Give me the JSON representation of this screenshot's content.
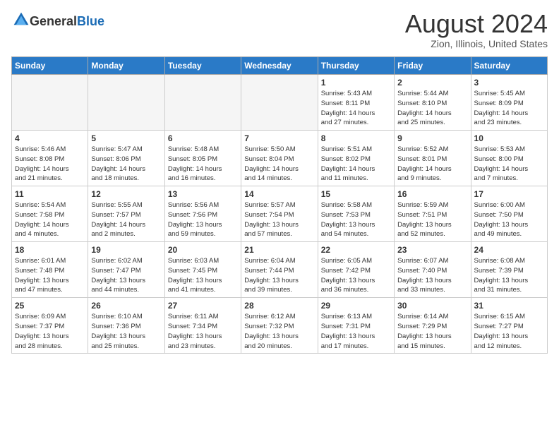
{
  "header": {
    "logo_general": "General",
    "logo_blue": "Blue",
    "title": "August 2024",
    "location": "Zion, Illinois, United States"
  },
  "days_of_week": [
    "Sunday",
    "Monday",
    "Tuesday",
    "Wednesday",
    "Thursday",
    "Friday",
    "Saturday"
  ],
  "weeks": [
    [
      {
        "day": "",
        "info": "",
        "empty": true
      },
      {
        "day": "",
        "info": "",
        "empty": true
      },
      {
        "day": "",
        "info": "",
        "empty": true
      },
      {
        "day": "",
        "info": "",
        "empty": true
      },
      {
        "day": "1",
        "info": "Sunrise: 5:43 AM\nSunset: 8:11 PM\nDaylight: 14 hours\nand 27 minutes."
      },
      {
        "day": "2",
        "info": "Sunrise: 5:44 AM\nSunset: 8:10 PM\nDaylight: 14 hours\nand 25 minutes."
      },
      {
        "day": "3",
        "info": "Sunrise: 5:45 AM\nSunset: 8:09 PM\nDaylight: 14 hours\nand 23 minutes."
      }
    ],
    [
      {
        "day": "4",
        "info": "Sunrise: 5:46 AM\nSunset: 8:08 PM\nDaylight: 14 hours\nand 21 minutes."
      },
      {
        "day": "5",
        "info": "Sunrise: 5:47 AM\nSunset: 8:06 PM\nDaylight: 14 hours\nand 18 minutes."
      },
      {
        "day": "6",
        "info": "Sunrise: 5:48 AM\nSunset: 8:05 PM\nDaylight: 14 hours\nand 16 minutes."
      },
      {
        "day": "7",
        "info": "Sunrise: 5:50 AM\nSunset: 8:04 PM\nDaylight: 14 hours\nand 14 minutes."
      },
      {
        "day": "8",
        "info": "Sunrise: 5:51 AM\nSunset: 8:02 PM\nDaylight: 14 hours\nand 11 minutes."
      },
      {
        "day": "9",
        "info": "Sunrise: 5:52 AM\nSunset: 8:01 PM\nDaylight: 14 hours\nand 9 minutes."
      },
      {
        "day": "10",
        "info": "Sunrise: 5:53 AM\nSunset: 8:00 PM\nDaylight: 14 hours\nand 7 minutes."
      }
    ],
    [
      {
        "day": "11",
        "info": "Sunrise: 5:54 AM\nSunset: 7:58 PM\nDaylight: 14 hours\nand 4 minutes."
      },
      {
        "day": "12",
        "info": "Sunrise: 5:55 AM\nSunset: 7:57 PM\nDaylight: 14 hours\nand 2 minutes."
      },
      {
        "day": "13",
        "info": "Sunrise: 5:56 AM\nSunset: 7:56 PM\nDaylight: 13 hours\nand 59 minutes."
      },
      {
        "day": "14",
        "info": "Sunrise: 5:57 AM\nSunset: 7:54 PM\nDaylight: 13 hours\nand 57 minutes."
      },
      {
        "day": "15",
        "info": "Sunrise: 5:58 AM\nSunset: 7:53 PM\nDaylight: 13 hours\nand 54 minutes."
      },
      {
        "day": "16",
        "info": "Sunrise: 5:59 AM\nSunset: 7:51 PM\nDaylight: 13 hours\nand 52 minutes."
      },
      {
        "day": "17",
        "info": "Sunrise: 6:00 AM\nSunset: 7:50 PM\nDaylight: 13 hours\nand 49 minutes."
      }
    ],
    [
      {
        "day": "18",
        "info": "Sunrise: 6:01 AM\nSunset: 7:48 PM\nDaylight: 13 hours\nand 47 minutes."
      },
      {
        "day": "19",
        "info": "Sunrise: 6:02 AM\nSunset: 7:47 PM\nDaylight: 13 hours\nand 44 minutes."
      },
      {
        "day": "20",
        "info": "Sunrise: 6:03 AM\nSunset: 7:45 PM\nDaylight: 13 hours\nand 41 minutes."
      },
      {
        "day": "21",
        "info": "Sunrise: 6:04 AM\nSunset: 7:44 PM\nDaylight: 13 hours\nand 39 minutes."
      },
      {
        "day": "22",
        "info": "Sunrise: 6:05 AM\nSunset: 7:42 PM\nDaylight: 13 hours\nand 36 minutes."
      },
      {
        "day": "23",
        "info": "Sunrise: 6:07 AM\nSunset: 7:40 PM\nDaylight: 13 hours\nand 33 minutes."
      },
      {
        "day": "24",
        "info": "Sunrise: 6:08 AM\nSunset: 7:39 PM\nDaylight: 13 hours\nand 31 minutes."
      }
    ],
    [
      {
        "day": "25",
        "info": "Sunrise: 6:09 AM\nSunset: 7:37 PM\nDaylight: 13 hours\nand 28 minutes."
      },
      {
        "day": "26",
        "info": "Sunrise: 6:10 AM\nSunset: 7:36 PM\nDaylight: 13 hours\nand 25 minutes."
      },
      {
        "day": "27",
        "info": "Sunrise: 6:11 AM\nSunset: 7:34 PM\nDaylight: 13 hours\nand 23 minutes."
      },
      {
        "day": "28",
        "info": "Sunrise: 6:12 AM\nSunset: 7:32 PM\nDaylight: 13 hours\nand 20 minutes."
      },
      {
        "day": "29",
        "info": "Sunrise: 6:13 AM\nSunset: 7:31 PM\nDaylight: 13 hours\nand 17 minutes."
      },
      {
        "day": "30",
        "info": "Sunrise: 6:14 AM\nSunset: 7:29 PM\nDaylight: 13 hours\nand 15 minutes."
      },
      {
        "day": "31",
        "info": "Sunrise: 6:15 AM\nSunset: 7:27 PM\nDaylight: 13 hours\nand 12 minutes."
      }
    ]
  ]
}
